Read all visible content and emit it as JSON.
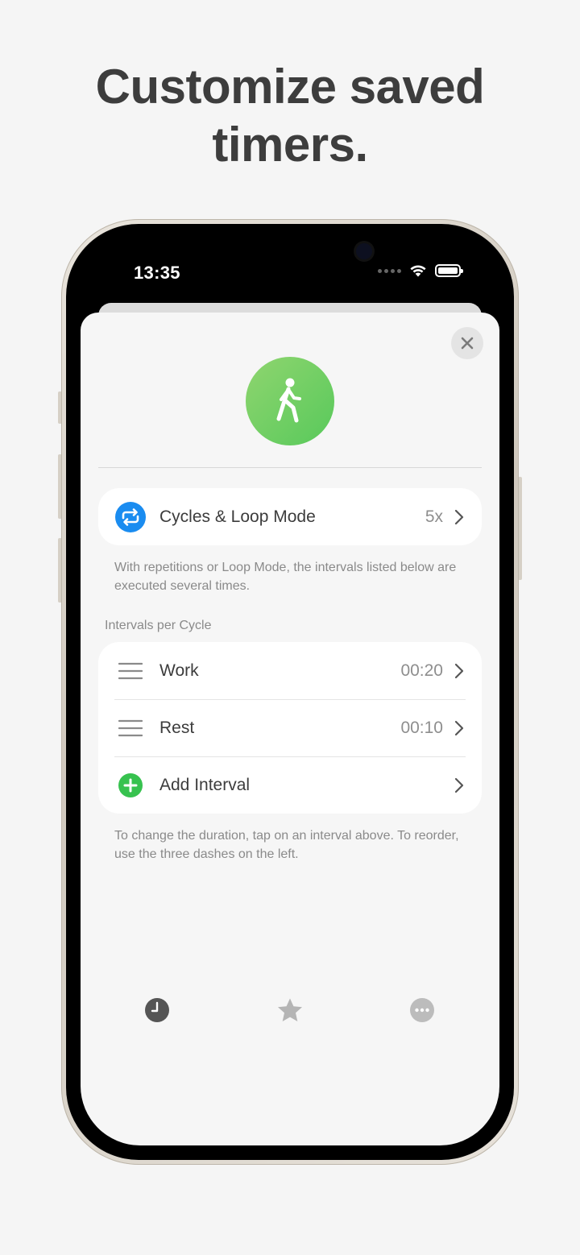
{
  "headline": {
    "line1": "Customize saved",
    "line2": "timers."
  },
  "status_bar": {
    "time": "13:35"
  },
  "sheet": {
    "close_icon": "close-icon",
    "timer_icon": "walking-figure-icon",
    "cycles_row": {
      "icon": "repeat-icon",
      "label": "Cycles & Loop Mode",
      "value": "5x"
    },
    "cycles_note": "With repetitions or Loop Mode, the intervals listed below are executed several times.",
    "intervals_header": "Intervals per Cycle",
    "intervals": [
      {
        "label": "Work",
        "value": "00:20"
      },
      {
        "label": "Rest",
        "value": "00:10"
      }
    ],
    "add_interval": {
      "icon": "plus-circle-icon",
      "label": "Add Interval"
    },
    "intervals_note": "To change the duration, tap on an interval above. To reorder, use the three dashes on the left."
  },
  "tabbar": {
    "tabs": [
      "clock-icon",
      "star-icon",
      "more-icon"
    ]
  },
  "colors": {
    "accent_blue": "#1a8cf0",
    "accent_green": "#37c24f",
    "timer_gradient_start": "#8fd56f",
    "timer_gradient_end": "#58c95b"
  }
}
